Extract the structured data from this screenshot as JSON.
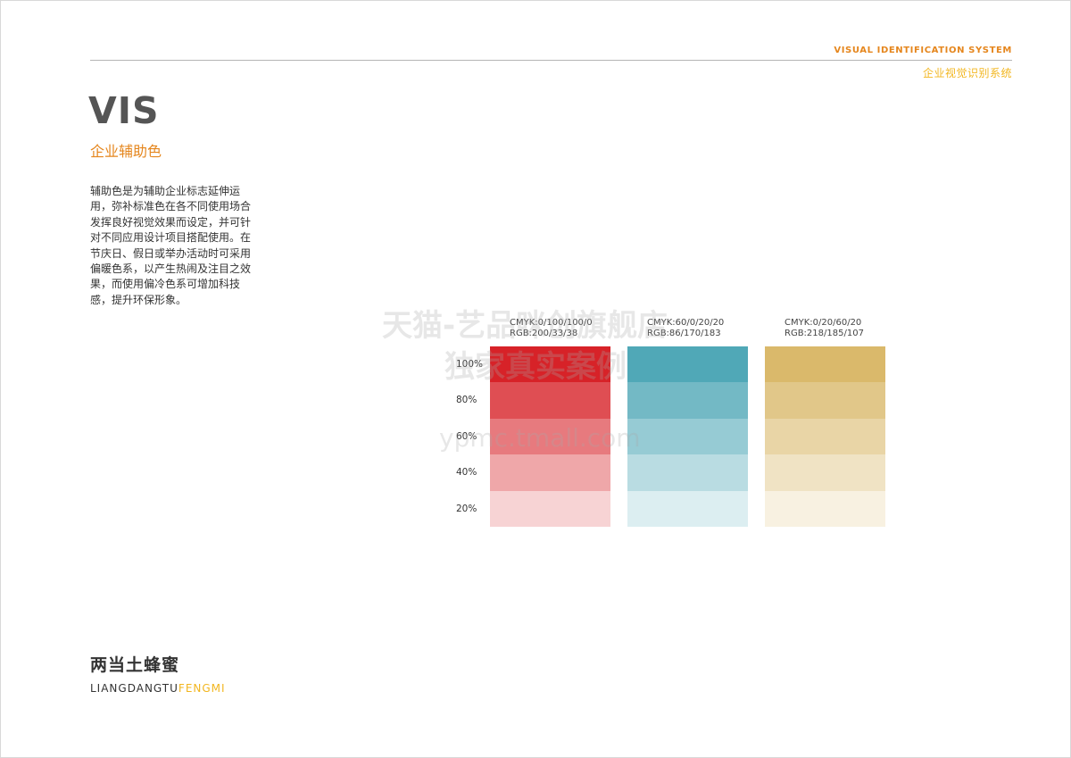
{
  "header": {
    "title_en": "VISUAL IDENTIFICATION SYSTEM",
    "title_cn": "企业视觉识别系统"
  },
  "section": {
    "title": "VIS",
    "subtitle": "企业辅助色",
    "description": "辅助色是为辅助企业标志延伸运用，弥补标准色在各不同使用场合发挥良好视觉效果而设定，并可针对不同应用设计项目搭配使用。在节庆日、假日或举办活动时可采用偏暖色系，以产生热闹及注目之效果，而使用偏冷色系可增加科技感，提升环保形象。"
  },
  "tint_levels": [
    "100%",
    "80%",
    "60%",
    "40%",
    "20%"
  ],
  "tint_alphas": [
    1,
    0.8,
    0.6,
    0.4,
    0.2
  ],
  "colors": [
    {
      "cmyk": "CMYK:0/100/100/0",
      "rgb": "RGB:200/33/38",
      "hex": "#d72228"
    },
    {
      "cmyk": "CMYK:60/0/20/20",
      "rgb": "RGB:86/170/183",
      "hex": "#50a8b7"
    },
    {
      "cmyk": "CMYK:0/20/60/20",
      "rgb": "RGB:218/185/107",
      "hex": "#dab96b"
    }
  ],
  "watermark": {
    "line1": "天猫-艺品咪创旗舰店",
    "line2": "独家真实案例",
    "line3": "ypmc.tmall.com"
  },
  "brand": {
    "name_cn": "两当土蜂蜜",
    "name_en_a": "LIANGDANGTU",
    "name_en_b": "FENGMI"
  },
  "accent_colors": {
    "orange": "#e5861d",
    "yellow": "#f2b61f",
    "title_gray": "#555555"
  }
}
